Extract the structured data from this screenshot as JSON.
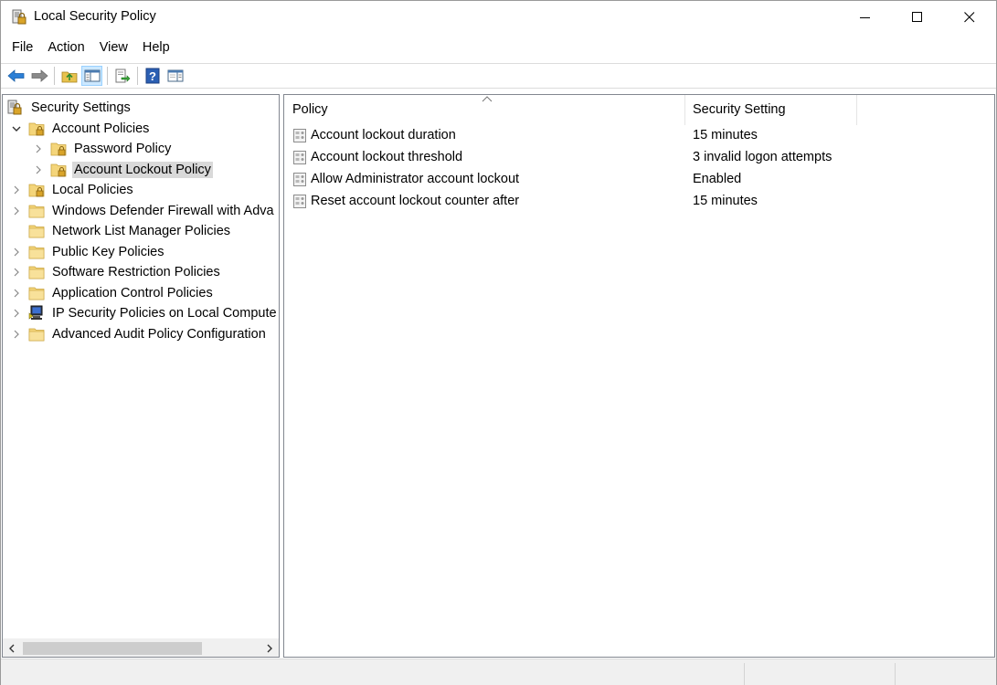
{
  "window": {
    "title": "Local Security Policy",
    "icon": "security-policy-icon"
  },
  "menu": {
    "items": [
      "File",
      "Action",
      "View",
      "Help"
    ]
  },
  "toolbar": {
    "buttons": [
      "back-arrow-icon",
      "forward-arrow-icon",
      "up-folder-icon",
      "show-hide-tree-icon",
      "export-list-icon",
      "help-icon",
      "properties-pane-icon"
    ]
  },
  "tree": {
    "items": [
      {
        "label": "Security Settings",
        "level": 0,
        "expander": "none",
        "icon": "security-settings-icon"
      },
      {
        "label": "Account Policies",
        "level": 1,
        "expander": "expanded",
        "icon": "locked-folder-icon"
      },
      {
        "label": "Password Policy",
        "level": 2,
        "expander": "collapsed",
        "icon": "locked-folder-icon"
      },
      {
        "label": "Account Lockout Policy",
        "level": 2,
        "expander": "collapsed",
        "icon": "locked-folder-icon",
        "selected": true
      },
      {
        "label": "Local Policies",
        "level": 1,
        "expander": "collapsed",
        "icon": "locked-folder-icon"
      },
      {
        "label": "Windows Defender Firewall with Adva",
        "level": 1,
        "expander": "collapsed",
        "icon": "folder-icon"
      },
      {
        "label": "Network List Manager Policies",
        "level": 1,
        "expander": "none",
        "icon": "folder-icon"
      },
      {
        "label": "Public Key Policies",
        "level": 1,
        "expander": "collapsed",
        "icon": "folder-icon"
      },
      {
        "label": "Software Restriction Policies",
        "level": 1,
        "expander": "collapsed",
        "icon": "folder-icon"
      },
      {
        "label": "Application Control Policies",
        "level": 1,
        "expander": "collapsed",
        "icon": "folder-icon"
      },
      {
        "label": "IP Security Policies on Local Compute",
        "level": 1,
        "expander": "collapsed",
        "icon": "ip-security-icon"
      },
      {
        "label": "Advanced Audit Policy Configuration",
        "level": 1,
        "expander": "collapsed",
        "icon": "folder-icon"
      }
    ]
  },
  "list": {
    "columns": [
      "Policy",
      "Security Setting"
    ],
    "rows": [
      {
        "policy": "Account lockout duration",
        "setting": "15 minutes"
      },
      {
        "policy": "Account lockout threshold",
        "setting": "3 invalid logon attempts"
      },
      {
        "policy": "Allow Administrator account lockout",
        "setting": "Enabled"
      },
      {
        "policy": "Reset account lockout counter after",
        "setting": "15 minutes"
      }
    ]
  },
  "colors": {
    "selection": "#d9d9d9",
    "folder": "#f4d57a",
    "toolbar_active": "#cce8ff"
  }
}
